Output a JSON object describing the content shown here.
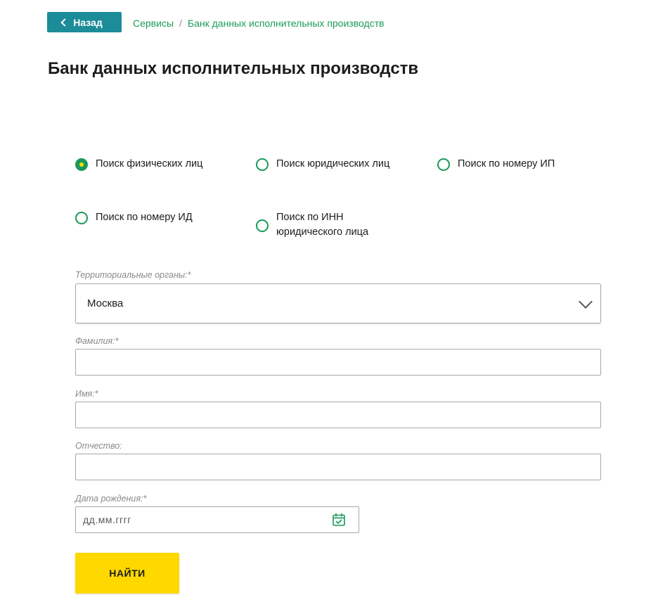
{
  "back_button": {
    "label": "Назад"
  },
  "breadcrumb": {
    "items": [
      "Сервисы",
      "Банк данных исполнительных производств"
    ],
    "separator": "/"
  },
  "page_title": "Банк данных исполнительных производств",
  "search_types": [
    {
      "label": "Поиск физических лиц",
      "selected": true
    },
    {
      "label": "Поиск юридических лиц",
      "selected": false
    },
    {
      "label": "Поиск по номеру ИП",
      "selected": false
    },
    {
      "label": "Поиск по номеру ИД",
      "selected": false
    },
    {
      "label": "Поиск по ИНН юридического лица",
      "selected": false
    }
  ],
  "form": {
    "territory": {
      "label": "Территориальные органы:*",
      "value": "Москва"
    },
    "lastname": {
      "label": "Фамилия:*",
      "value": ""
    },
    "firstname": {
      "label": "Имя:*",
      "value": ""
    },
    "patronymic": {
      "label": "Отчество:",
      "value": ""
    },
    "birthdate": {
      "label": "Дата рождения:*",
      "placeholder": "дд.мм.гггг",
      "value": ""
    }
  },
  "submit": {
    "label": "НАЙТИ"
  },
  "colors": {
    "accent_green": "#1a9a5a",
    "teal_button": "#1c8c99",
    "yellow_button": "#ffd800"
  },
  "icons": {
    "back": "chevron-left-icon",
    "select": "chevron-down-icon",
    "calendar": "calendar-icon"
  }
}
